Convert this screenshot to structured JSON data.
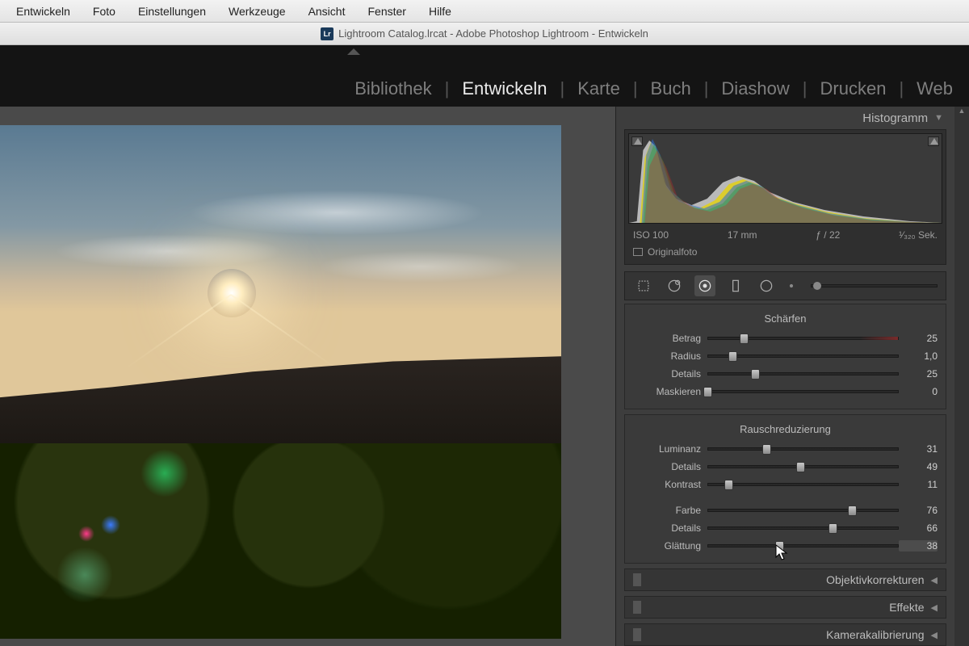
{
  "os_menu": [
    "Entwickeln",
    "Foto",
    "Einstellungen",
    "Werkzeuge",
    "Ansicht",
    "Fenster",
    "Hilfe"
  ],
  "window_title": "Lightroom Catalog.lrcat - Adobe Photoshop Lightroom - Entwickeln",
  "modules": [
    "Bibliothek",
    "Entwickeln",
    "Karte",
    "Buch",
    "Diashow",
    "Drucken",
    "Web"
  ],
  "active_module": "Entwickeln",
  "histogram": {
    "title": "Histogramm",
    "meta": {
      "iso": "ISO 100",
      "focal": "17 mm",
      "aperture": "ƒ / 22",
      "shutter": "¹⁄₃₂₀ Sek."
    },
    "original_label": "Originalfoto"
  },
  "tools": [
    "crop",
    "spot",
    "redeye",
    "graduated",
    "radial",
    "brush"
  ],
  "sharpen": {
    "title": "Schärfen",
    "rows": [
      {
        "label": "Betrag",
        "value": "25",
        "pos": 19
      },
      {
        "label": "Radius",
        "value": "1,0",
        "pos": 13
      },
      {
        "label": "Details",
        "value": "25",
        "pos": 25
      },
      {
        "label": "Maskieren",
        "value": "0",
        "pos": 0
      }
    ]
  },
  "noise": {
    "title": "Rauschreduzierung",
    "rows": [
      {
        "label": "Luminanz",
        "value": "31",
        "pos": 31
      },
      {
        "label": "Details",
        "value": "49",
        "pos": 49
      },
      {
        "label": "Kontrast",
        "value": "11",
        "pos": 11
      }
    ],
    "rows2": [
      {
        "label": "Farbe",
        "value": "76",
        "pos": 76
      },
      {
        "label": "Details",
        "value": "66",
        "pos": 66
      },
      {
        "label": "Glättung",
        "value": "38",
        "pos": 38,
        "hl": true
      }
    ]
  },
  "collapsed_panels": [
    "Objektivkorrekturen",
    "Effekte",
    "Kamerakalibrierung"
  ]
}
